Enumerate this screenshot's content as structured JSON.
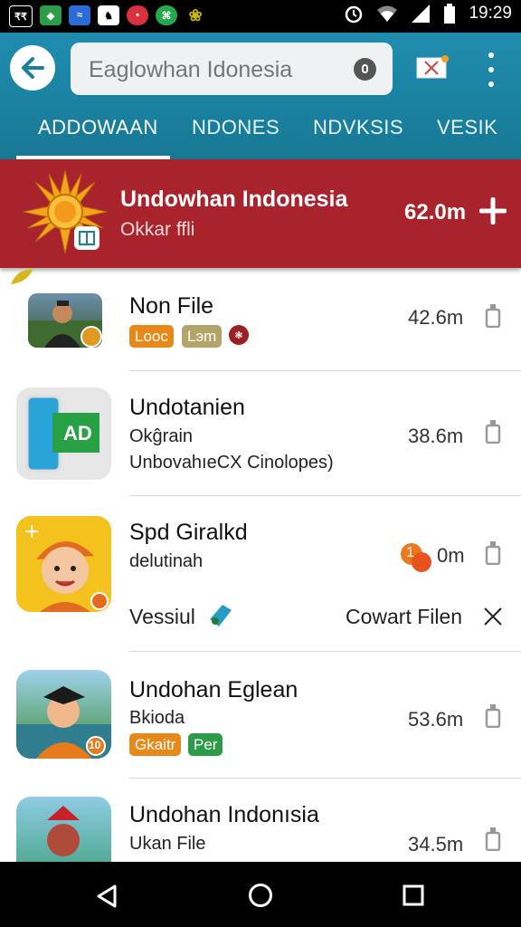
{
  "status_bar": {
    "time": "19:29",
    "app_icons": [
      "₹₹",
      "◆",
      "≈",
      "♞",
      "•",
      "⌘",
      "❀"
    ],
    "icon_colors": [
      "#000000",
      "#2a9d4a",
      "#2b6cd6",
      "#ffffff",
      "#d8323c",
      "#26a84d",
      "#c7b800"
    ]
  },
  "app_bar": {
    "search_placeholder": "Eaglowhan Idonesia",
    "tabs": [
      "ADDOWAAN",
      "NDONES",
      "NDVKSIS",
      "VESIK"
    ]
  },
  "featured": {
    "title": "Undowhan Indonesia",
    "subtitle": "Okkar ffli",
    "size": "62.0m"
  },
  "items": [
    {
      "name": "Non File",
      "size": "42.6m",
      "tags": [
        {
          "label": "Looc",
          "color": "#e6891a"
        },
        {
          "label": "Lэm",
          "color": "#b5a46a"
        }
      ]
    },
    {
      "name": "Undotanien",
      "line1": "Okĝrain",
      "line2": "UnbovahıeCX Cinolopes)",
      "size": "38.6m",
      "thumb_text": "AD"
    },
    {
      "name": "Spd Giralkd",
      "line1": "delutinah",
      "size": "0m",
      "progress_badge": "1",
      "action_left": "Vessiul",
      "action_right": "Cowart Filen"
    },
    {
      "name": "Undohan Eglean",
      "line1": "Bkioda",
      "size": "53.6m",
      "thumb_badge": "10",
      "tags": [
        {
          "label": "Gkaitr",
          "color": "#e6891a"
        },
        {
          "label": "Per",
          "color": "#2c9b4a"
        }
      ]
    },
    {
      "name": "Undohan Indonısia",
      "line1": "Ukan File",
      "size": "34.5m"
    }
  ]
}
